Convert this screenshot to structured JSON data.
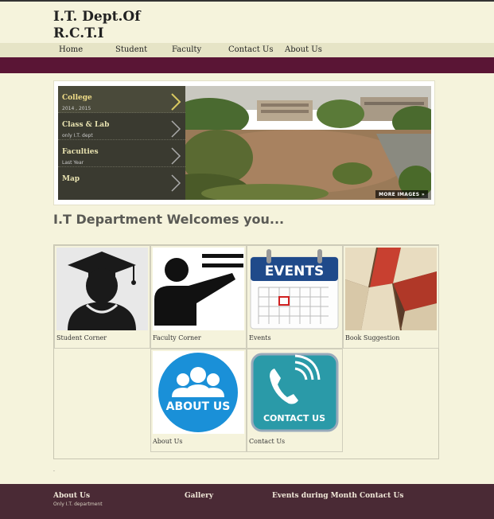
{
  "header": {
    "title_line1": "I.T. Dept.Of",
    "title_line2": "R.C.T.I"
  },
  "nav": {
    "items": [
      "Home",
      "Student",
      "Faculty",
      "Contact Us",
      "About Us"
    ]
  },
  "slider": {
    "items": [
      {
        "title": "College",
        "subtitle": "2014 , 2015"
      },
      {
        "title": "Class & Lab",
        "subtitle": "only I.T. dept"
      },
      {
        "title": "Faculties",
        "subtitle": "Last Year"
      },
      {
        "title": "Map",
        "subtitle": ""
      }
    ],
    "more_images": "MORE IMAGES »"
  },
  "welcome": "I.T Department Welcomes you...",
  "tiles": [
    {
      "label": "Student Corner",
      "icon": "student-icon"
    },
    {
      "label": "Faculty Corner",
      "icon": "teacher-icon"
    },
    {
      "label": "Events",
      "icon": "calendar-icon",
      "image_text": "EVENTS"
    },
    {
      "label": "Book Suggestion",
      "icon": "books-icon"
    },
    {
      "label": "About Us",
      "icon": "users-icon",
      "image_text": "ABOUT US"
    },
    {
      "label": "Contact Us",
      "icon": "phone-icon",
      "image_text": "CONTACT US"
    }
  ],
  "dot": ".",
  "footer": {
    "about_title": "About Us",
    "about_sub": "Only I.T. department",
    "gallery": "Gallery",
    "events": "Events during Month",
    "contact": "Contact Us"
  },
  "colors": {
    "background": "#f5f3dc",
    "maroon": "#5a1535",
    "footer": "#4a2a35",
    "nav": "#e6e4c6"
  }
}
